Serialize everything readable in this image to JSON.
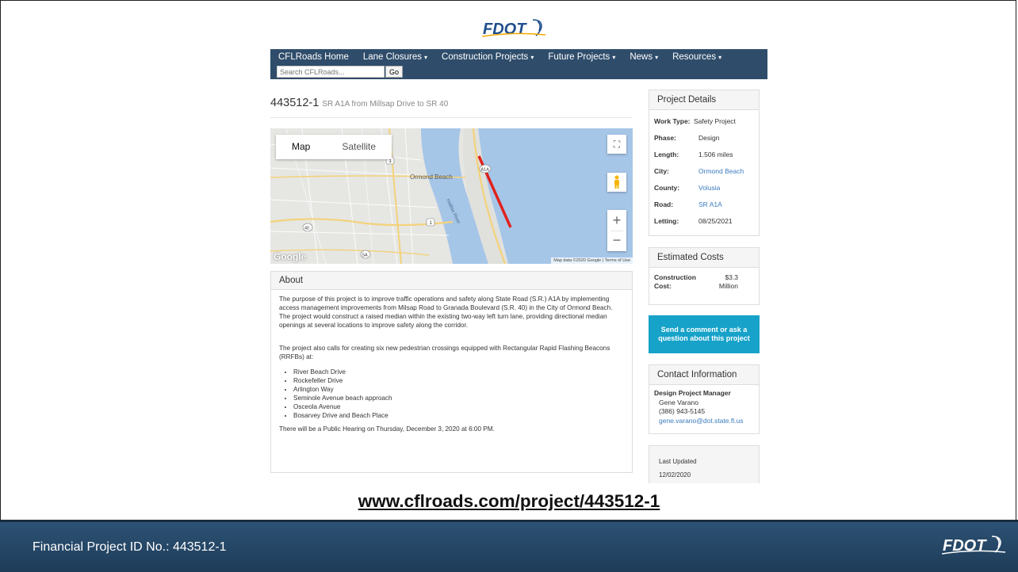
{
  "logo_text": "FDOT",
  "nav": {
    "items": [
      {
        "label": "CFLRoads Home",
        "dropdown": false
      },
      {
        "label": "Lane Closures",
        "dropdown": true
      },
      {
        "label": "Construction Projects",
        "dropdown": true
      },
      {
        "label": "Future Projects",
        "dropdown": true
      },
      {
        "label": "News",
        "dropdown": true
      },
      {
        "label": "Resources",
        "dropdown": true
      }
    ],
    "search_placeholder": "Search CFLRoads...",
    "go_label": "Go"
  },
  "project": {
    "id": "443512-1",
    "subtitle": "SR A1A from Millsap Drive to SR 40"
  },
  "map": {
    "type_map": "Map",
    "type_satellite": "Satellite",
    "google_label": "Google",
    "attribution": "Map data ©2020 Google | Terms of Use",
    "labels": {
      "city": "Ormond Beach",
      "river": "Halifax River",
      "shield_a1a": "A1A",
      "shield_1a": "1",
      "shield_1b": "1",
      "shield_40": "40",
      "shield_5a": "5A"
    },
    "colors": {
      "water": "#a6c6e8",
      "land": "#e6e6e3",
      "highlight": "#e0221c"
    }
  },
  "about": {
    "heading": "About",
    "p1": "The purpose of this project is to improve traffic operations and safety along State Road (S.R.) A1A by implementing access management improvements from Milsap Road to Granada Boulevard (S.R. 40) in the City of Ormond Beach. The project would construct a raised median within the existing two-way left turn lane, providing directional median openings at several locations to improve safety along the corridor.",
    "p2": "The project also calls for creating six new pedestrian crossings equipped with Rectangular Rapid Flashing Beacons (RRFBs) at:",
    "crossings": [
      "River Beach Drive",
      "Rockefeller Drive",
      "Arlington Way",
      "Seminole Avenue beach approach",
      "Osceola Avenue",
      "Bosarvey Drive and Beach Place"
    ],
    "p3": "There will be a Public Hearing on Thursday, December 3, 2020 at 6:00 PM."
  },
  "details": {
    "heading": "Project Details",
    "rows": [
      {
        "key": "Work Type:",
        "value": "Safety Project",
        "link": false
      },
      {
        "key": "Phase:",
        "value": "Design",
        "link": false
      },
      {
        "key": "Length:",
        "value": "1.506 miles",
        "link": false
      },
      {
        "key": "City:",
        "value": "Ormond Beach",
        "link": true
      },
      {
        "key": "County:",
        "value": "Volusia",
        "link": true
      },
      {
        "key": "Road:",
        "value": "SR A1A",
        "link": true
      },
      {
        "key": "Letting:",
        "value": "08/25/2021",
        "link": false
      }
    ]
  },
  "costs": {
    "heading": "Estimated Costs",
    "label": "Construction Cost:",
    "value": "$3.3 Million"
  },
  "cta_label": "Send a comment or ask a question about this project",
  "contact": {
    "heading": "Contact Information",
    "role": "Design Project Manager",
    "name": "Gene Varano",
    "phone": "(386) 943-5145",
    "email": "gene.varano@dot.state.fl.us"
  },
  "updated": {
    "label": "Last Updated",
    "date": "12/02/2020"
  },
  "url": "www.cflroads.com/project/443512-1",
  "footer": {
    "text": "Financial Project ID No.: 443512-1"
  }
}
